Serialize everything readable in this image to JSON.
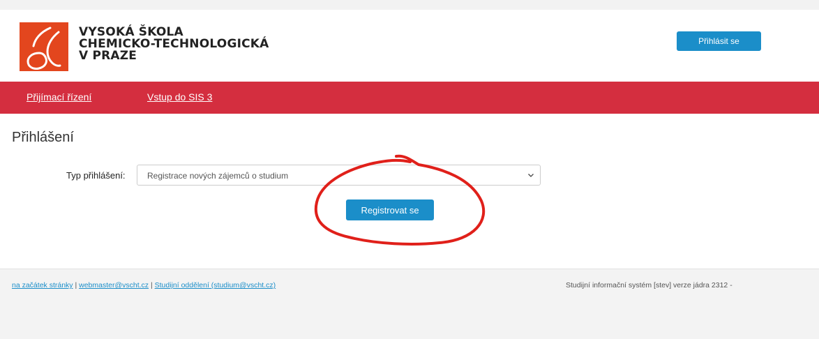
{
  "header": {
    "logo_lines": [
      "VYSOKÁ ŠKOLA",
      "CHEMICKO-TECHNOLOGICKÁ",
      "V PRAZE"
    ],
    "login_button": "Přihlásit se"
  },
  "nav": {
    "items": [
      {
        "label": "Přijímací řízení"
      },
      {
        "label": "Vstup do SIS 3"
      }
    ]
  },
  "main": {
    "title": "Přihlášení",
    "login_type_label": "Typ přihlášení:",
    "login_type_value": "Registrace nových zájemců o studium",
    "register_button": "Registrovat se"
  },
  "footer": {
    "links": [
      {
        "label": "na začátek stránky"
      },
      {
        "label": "webmaster@vscht.cz"
      },
      {
        "label": "Studijní oddělení (studium@vscht.cz)"
      }
    ],
    "separator": "|",
    "system_info": "Studijní informační systém [stev] verze jádra 2312 -"
  },
  "colors": {
    "brand_orange": "#e3461e",
    "nav_red": "#d42e3f",
    "button_blue": "#1b8ec9",
    "annotation_red": "#e0201a"
  }
}
